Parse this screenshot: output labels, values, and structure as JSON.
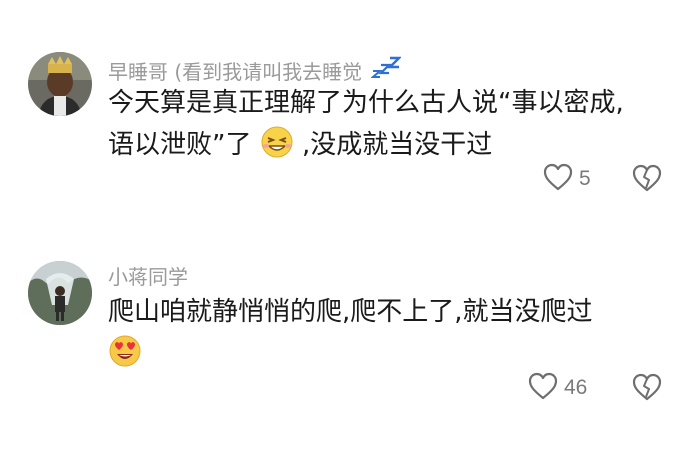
{
  "comments": [
    {
      "username": "早睡哥 (看到我请叫我去睡觉",
      "text_line1": "今天算是真正理解了为什么古人说“事以密成,",
      "text_line2_a": "语以泄败”了",
      "text_line2_b": ",没成就当没干过",
      "emoji": "grinning-squint-face",
      "like_count": "5"
    },
    {
      "username": "小蒋同学",
      "text_line1": "爬山咱就静悄悄的爬,爬不上了,就当没爬过",
      "emoji": "heart-eyes-face",
      "like_count": "46"
    }
  ],
  "colors": {
    "username": "#9a9a9a",
    "text": "#1a1a1a",
    "icon": "#6e6e6e",
    "zzz": "#2f6fd6"
  }
}
